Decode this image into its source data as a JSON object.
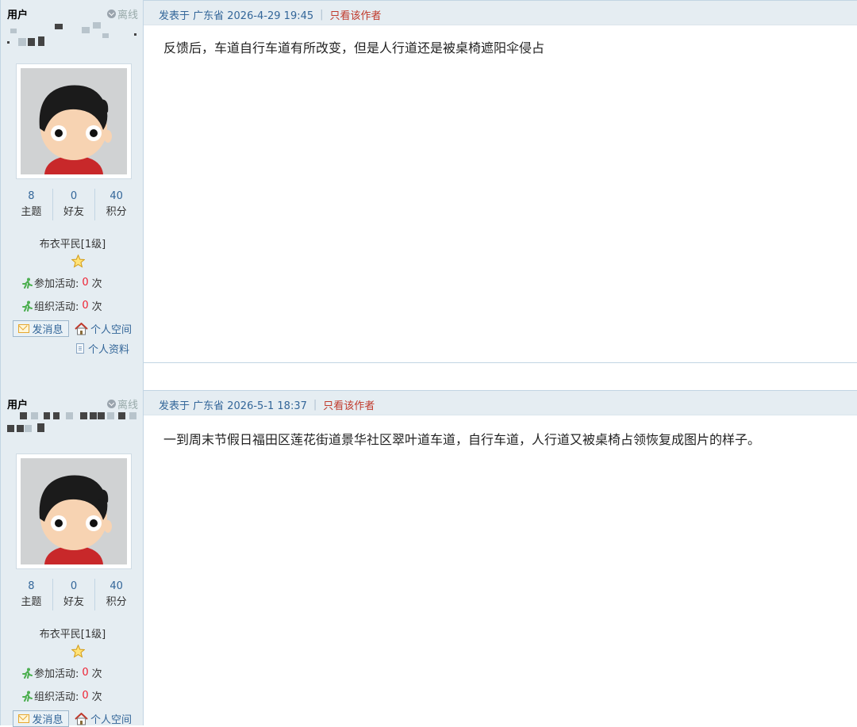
{
  "posts": [
    {
      "sidebar": {
        "user_label": "用户",
        "status": "离线",
        "stats": [
          {
            "num": "8",
            "label": "主题"
          },
          {
            "num": "0",
            "label": "好友"
          },
          {
            "num": "40",
            "label": "积分"
          }
        ],
        "rank": "布衣平民[1级]",
        "activities": [
          {
            "label": "参加活动:",
            "count": "0",
            "unit": "次"
          },
          {
            "label": "组织活动:",
            "count": "0",
            "unit": "次"
          }
        ],
        "send_message": "发消息",
        "personal_space": "个人空间",
        "personal_profile": "个人资料"
      },
      "meta": {
        "posted": "发表于 广东省 2026-4-29 19:45",
        "author_only": "只看该作者"
      },
      "body": "反馈后，车道自行车道有所改变，但是人行道还是被桌椅遮阳伞侵占"
    },
    {
      "sidebar": {
        "user_label": "用户",
        "status": "离线",
        "stats": [
          {
            "num": "8",
            "label": "主题"
          },
          {
            "num": "0",
            "label": "好友"
          },
          {
            "num": "40",
            "label": "积分"
          }
        ],
        "rank": "布衣平民[1级]",
        "activities": [
          {
            "label": "参加活动:",
            "count": "0",
            "unit": "次"
          },
          {
            "label": "组织活动:",
            "count": "0",
            "unit": "次"
          }
        ],
        "send_message": "发消息",
        "personal_space": "个人空间"
      },
      "meta": {
        "posted": "发表于 广东省 2026-5-1 18:37",
        "author_only": "只看该作者"
      },
      "body": "一到周末节假日福田区莲花街道景华社区翠叶道车道，自行车道，人行道又被桌椅占领恢复成图片的样子。"
    }
  ],
  "icons": {
    "offline": "offline-icon",
    "star": "star-icon",
    "activity": "running-man-icon",
    "message": "mail-icon",
    "space": "house-icon",
    "profile": "document-icon"
  },
  "colors": {
    "link": "#336699",
    "highlight": "#e23",
    "panel_bg": "#e5edf2",
    "border": "#c2d5e3"
  }
}
